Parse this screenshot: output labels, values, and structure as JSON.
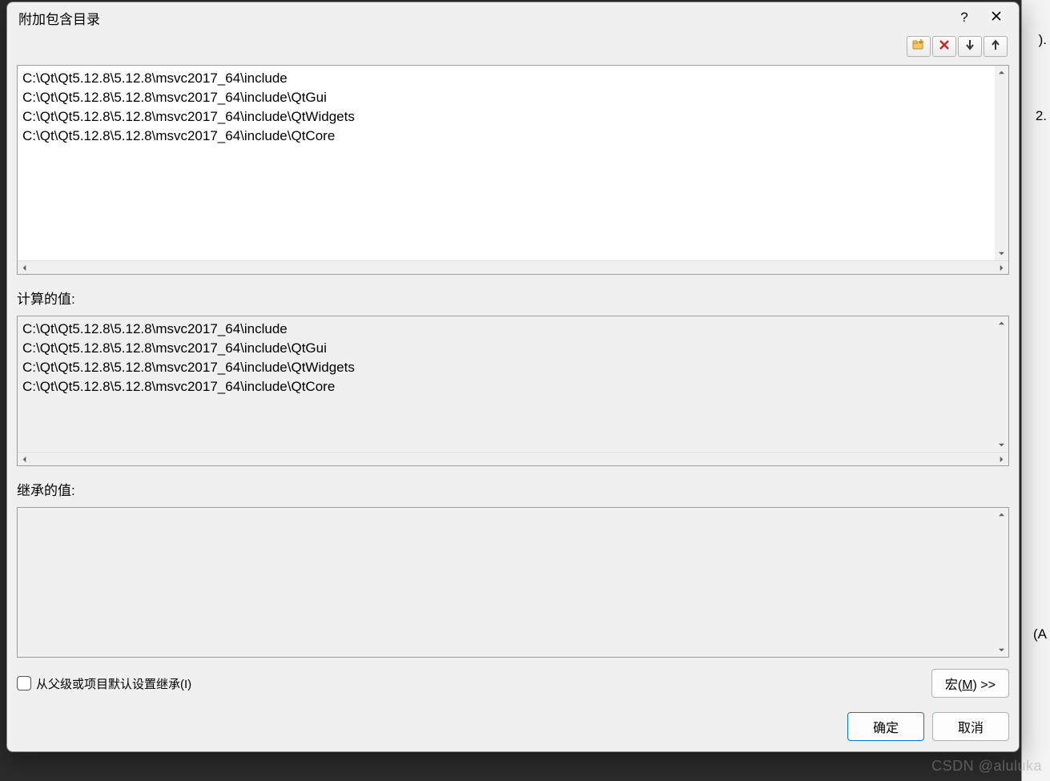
{
  "dialog": {
    "title": "附加包含目录"
  },
  "background": {
    "snippet1": ").",
    "snippet2": "2.",
    "snippet3": "(A",
    "watermark": "CSDN @aluluka"
  },
  "edit": {
    "paths": [
      "C:\\Qt\\Qt5.12.8\\5.12.8\\msvc2017_64\\include",
      "C:\\Qt\\Qt5.12.8\\5.12.8\\msvc2017_64\\include\\QtGui",
      "C:\\Qt\\Qt5.12.8\\5.12.8\\msvc2017_64\\include\\QtWidgets",
      "C:\\Qt\\Qt5.12.8\\5.12.8\\msvc2017_64\\include\\QtCore"
    ]
  },
  "calculated": {
    "label": "计算的值:",
    "paths": [
      "C:\\Qt\\Qt5.12.8\\5.12.8\\msvc2017_64\\include",
      "C:\\Qt\\Qt5.12.8\\5.12.8\\msvc2017_64\\include\\QtGui",
      "C:\\Qt\\Qt5.12.8\\5.12.8\\msvc2017_64\\include\\QtWidgets",
      "C:\\Qt\\Qt5.12.8\\5.12.8\\msvc2017_64\\include\\QtCore"
    ]
  },
  "inherited": {
    "label": "继承的值:",
    "paths": []
  },
  "footer": {
    "inherit_label": "从父级或项目默认设置继承(I)",
    "macros_prefix": "宏(",
    "macros_key": "M",
    "macros_suffix": ") >>",
    "ok": "确定",
    "cancel": "取消"
  }
}
